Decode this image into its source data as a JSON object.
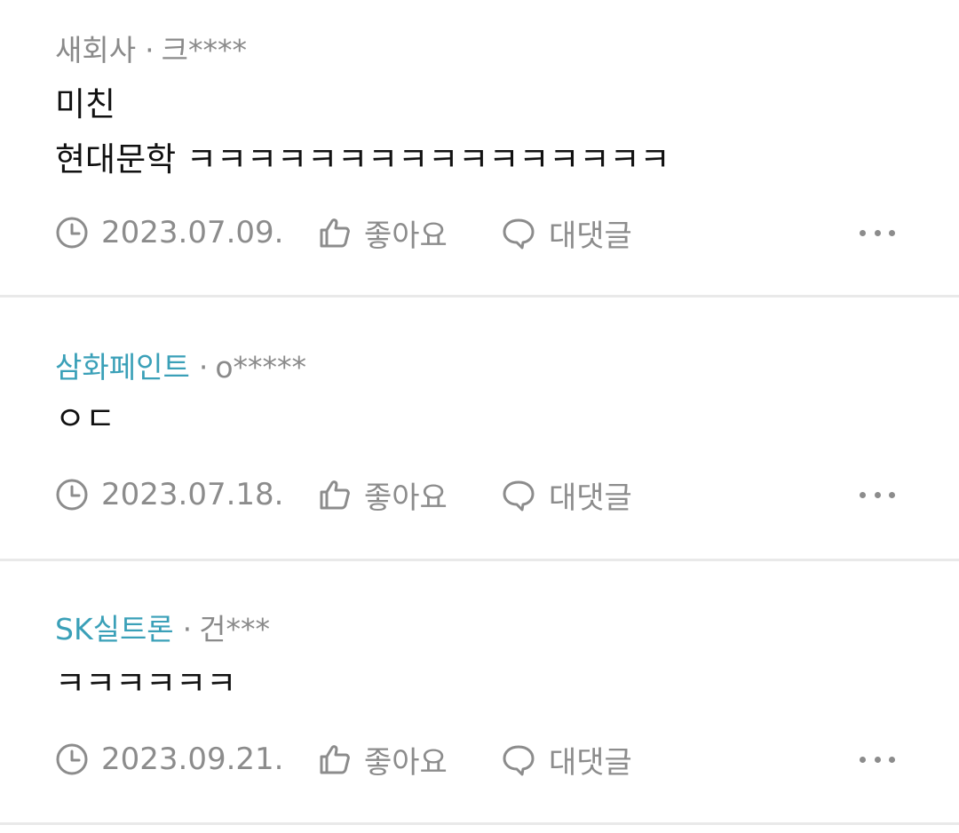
{
  "comments": [
    {
      "company": "새회사",
      "company_linked": false,
      "separator": "·",
      "author": "크****",
      "text": "미친\n현대문학 ㅋㅋㅋㅋㅋㅋㅋㅋㅋㅋㅋㅋㅋㅋㅋㅋ",
      "date": "2023.07.09.",
      "like_label": "좋아요",
      "reply_label": "대댓글"
    },
    {
      "company": "삼화페인트",
      "company_linked": true,
      "separator": "·",
      "author": "o*****",
      "text": "ㅇㄷ",
      "date": "2023.07.18.",
      "like_label": "좋아요",
      "reply_label": "대댓글"
    },
    {
      "company": "SK실트론",
      "company_linked": true,
      "separator": "·",
      "author": "건***",
      "text": "ㅋㅋㅋㅋㅋㅋ",
      "date": "2023.09.21.",
      "like_label": "좋아요",
      "reply_label": "대댓글"
    }
  ],
  "icons": {
    "date": "clock-icon",
    "like": "thumbs-up-icon",
    "reply": "speech-bubble-icon",
    "more": "more-dots-icon"
  },
  "colors": {
    "company_link": "#3aa0b8",
    "meta_gray": "#8a8a8a",
    "divider": "#e9e9e9"
  }
}
